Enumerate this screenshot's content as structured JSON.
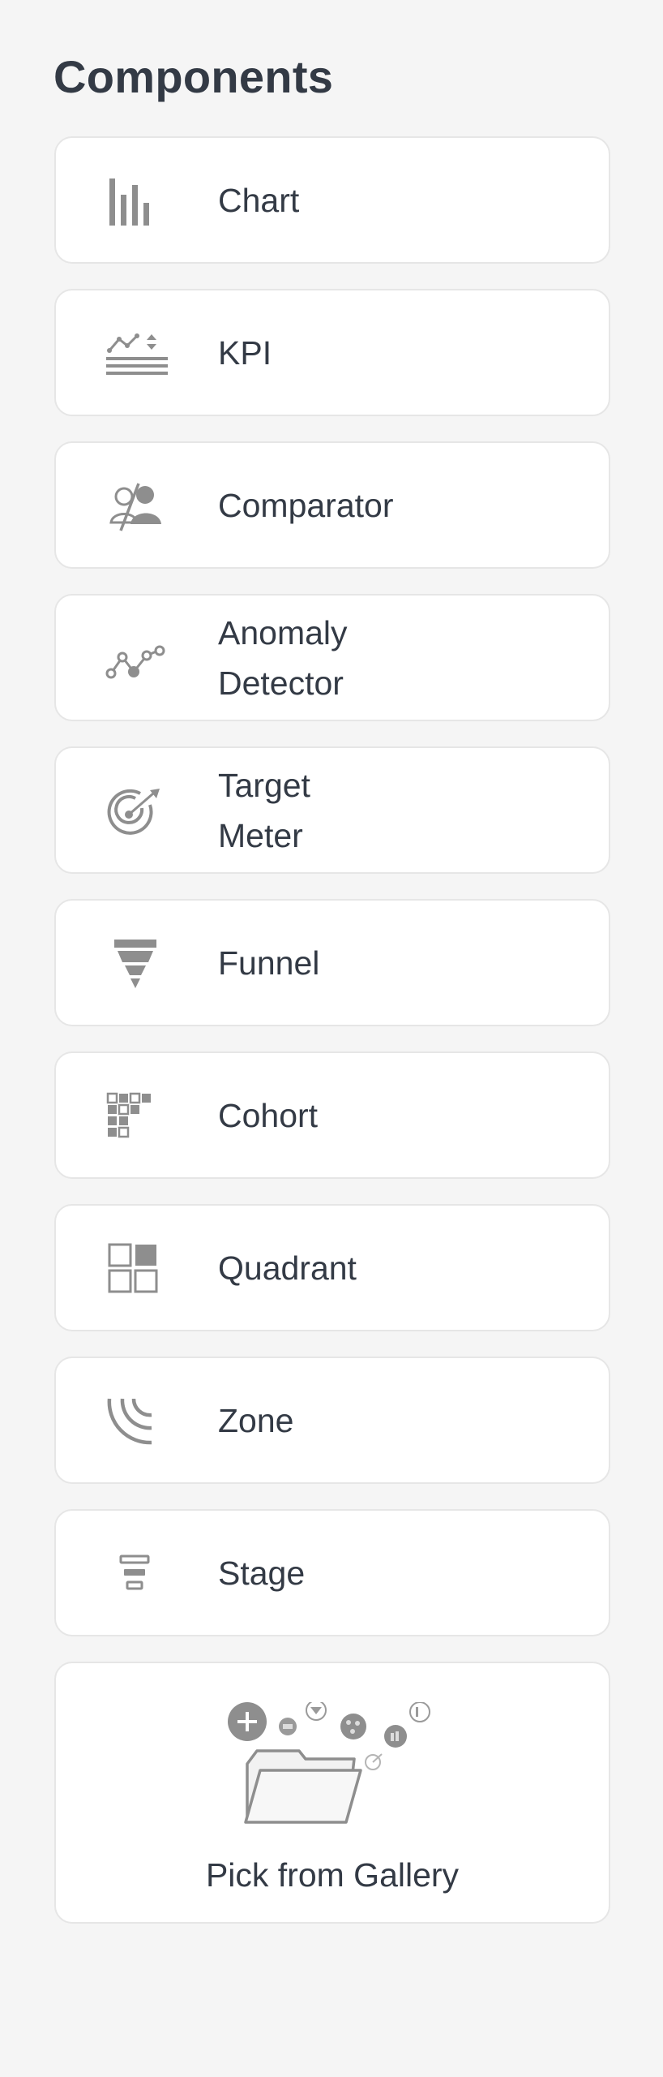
{
  "panel": {
    "title": "Components"
  },
  "components": [
    {
      "label": "Chart",
      "icon": "bar-chart-icon"
    },
    {
      "label": "KPI",
      "icon": "kpi-icon"
    },
    {
      "label": "Comparator",
      "icon": "comparator-icon"
    },
    {
      "label": "Anomaly\nDetector",
      "icon": "anomaly-detector-icon"
    },
    {
      "label": "Target\nMeter",
      "icon": "target-meter-icon"
    },
    {
      "label": "Funnel",
      "icon": "funnel-icon"
    },
    {
      "label": "Cohort",
      "icon": "cohort-icon"
    },
    {
      "label": "Quadrant",
      "icon": "quadrant-icon"
    },
    {
      "label": "Zone",
      "icon": "zone-icon"
    },
    {
      "label": "Stage",
      "icon": "stage-icon"
    }
  ],
  "gallery": {
    "label": "Pick from Gallery",
    "icon": "gallery-folder-icon"
  },
  "colors": {
    "background": "#f5f5f5",
    "card": "#ffffff",
    "card_border": "#e6e6e6",
    "text": "#333a45",
    "icon": "#8e8e8e"
  }
}
